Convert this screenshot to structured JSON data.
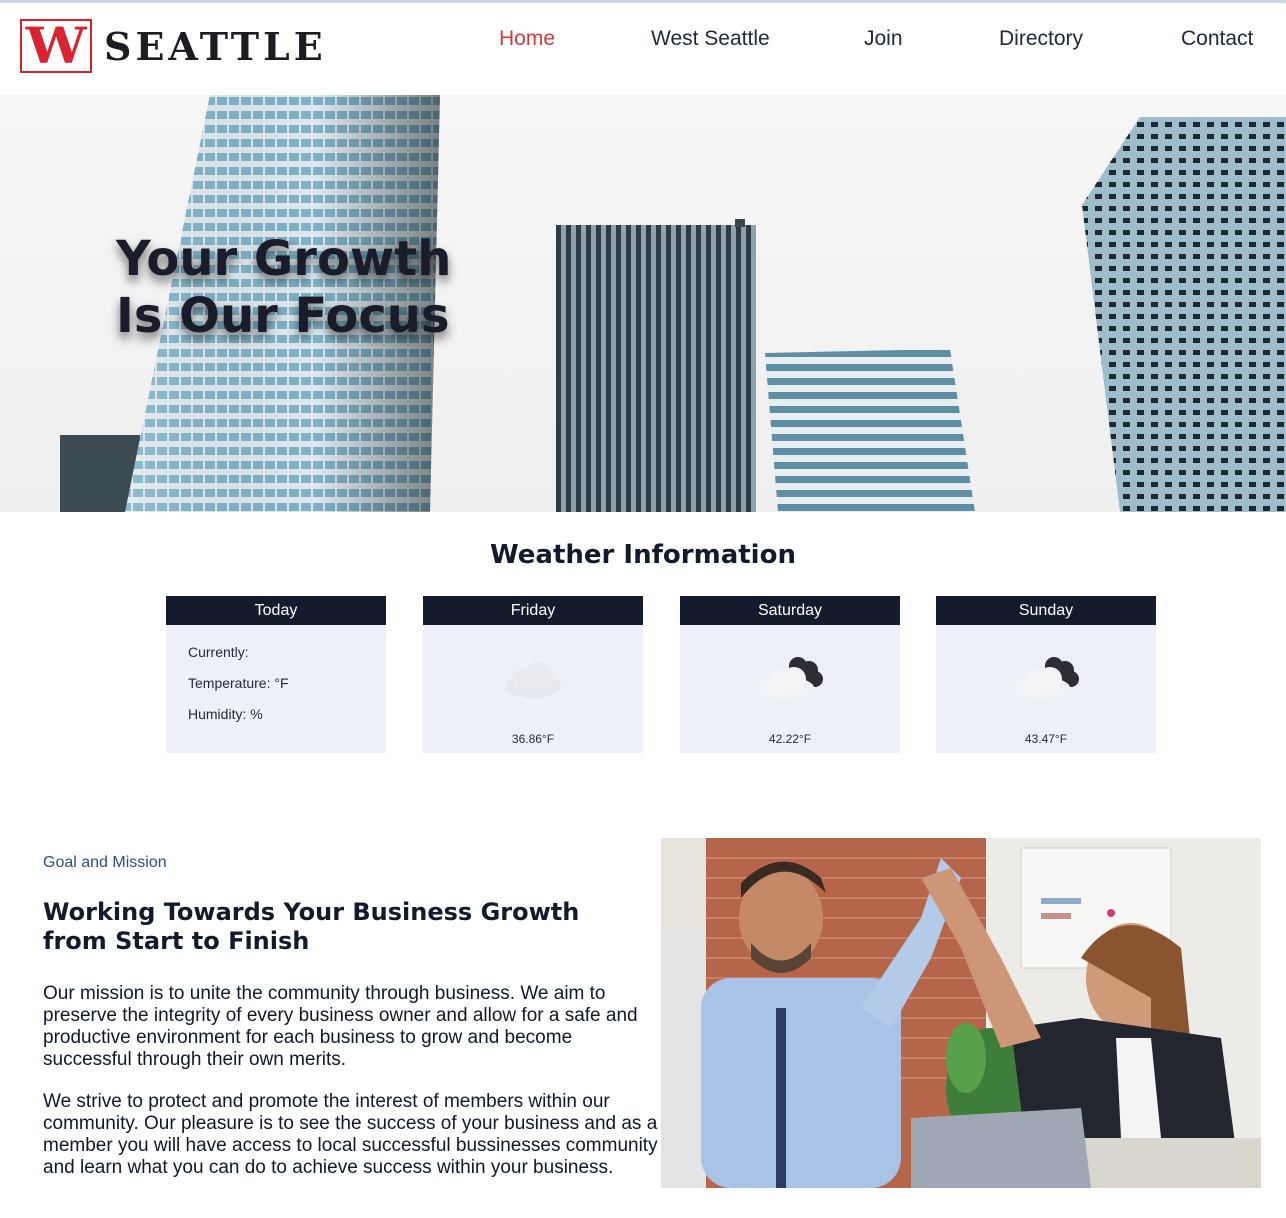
{
  "brand": {
    "logo_letter": "W",
    "logo_text": "SEATTLE",
    "accent_color": "#d9242f"
  },
  "nav": {
    "items": [
      {
        "label": "Home",
        "active": true
      },
      {
        "label": "West Seattle",
        "active": false
      },
      {
        "label": "Join",
        "active": false
      },
      {
        "label": "Directory",
        "active": false
      },
      {
        "label": "Contact",
        "active": false
      }
    ]
  },
  "hero": {
    "line1": "Your Growth",
    "line2": "Is Our Focus"
  },
  "weather": {
    "title": "Weather Information",
    "today": {
      "label": "Today",
      "currently": "Currently:",
      "temperature": "Temperature: °F",
      "humidity": "Humidity: %"
    },
    "forecast": [
      {
        "day": "Friday",
        "temp": "36.86°F",
        "icon": "cloud-icon"
      },
      {
        "day": "Saturday",
        "temp": "42.22°F",
        "icon": "partly-cloudy-icon"
      },
      {
        "day": "Sunday",
        "temp": "43.47°F",
        "icon": "partly-cloudy-icon"
      }
    ]
  },
  "mission": {
    "eyebrow": "Goal and Mission",
    "title": "Working Towards Your Business Growth from Start to Finish",
    "paragraph1": "Our mission is to unite the community through business. We aim to preserve the integrity of every business owner and allow for a safe and productive environment for each business to grow and become successful through their own merits.",
    "paragraph2": "We strive to protect and promote the interest of members within our community. Our pleasure is to see the success of your business and as a member you will have access to local successful bussinesses community and learn what you can do to achieve success within your business."
  }
}
